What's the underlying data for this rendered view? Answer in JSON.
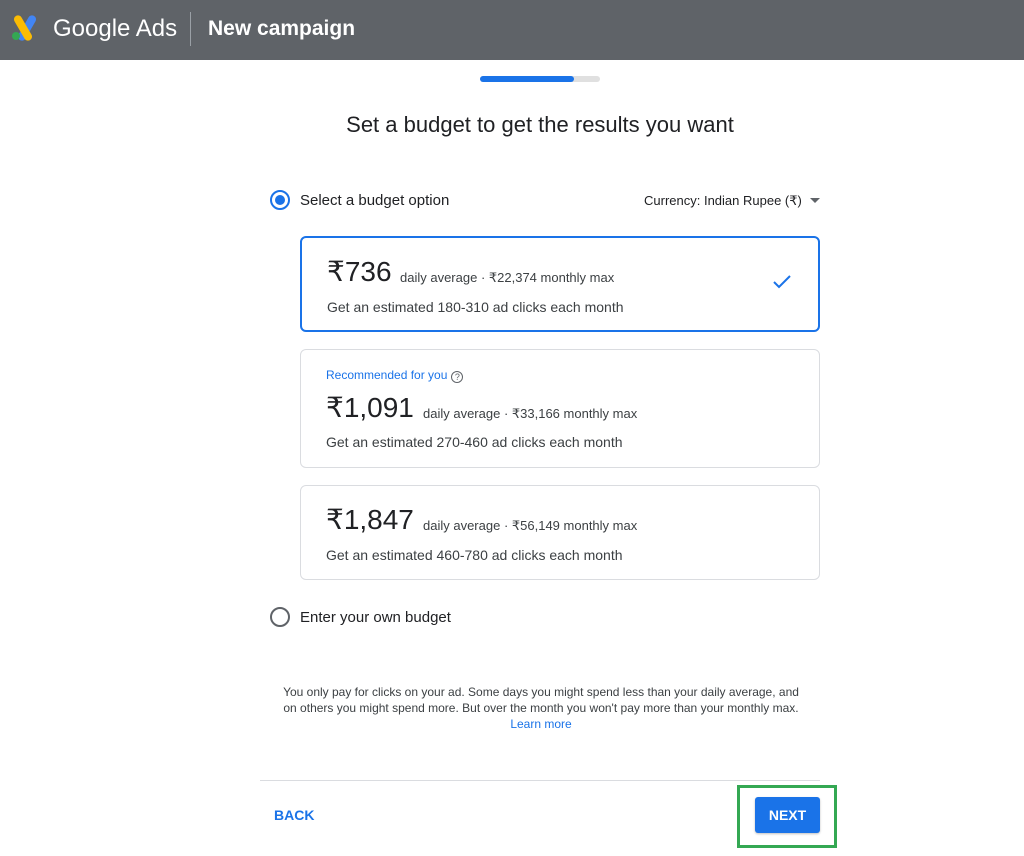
{
  "header": {
    "brand": "Google Ads",
    "page_name": "New campaign",
    "logo_icon": "google-ads-logo",
    "colors": {
      "bar": "#5f6368",
      "logo_blue": "#4285f4",
      "logo_yellow": "#fbbc04",
      "logo_green": "#34a853"
    }
  },
  "progress": {
    "fraction": 0.78
  },
  "headline": "Set a budget to get the results you want",
  "budget_option": {
    "label": "Select a budget option",
    "selected": true,
    "currency_label": "Currency: Indian Rupee (₹)",
    "currency_icon": "caret-down-icon"
  },
  "cards": [
    {
      "recommended": "",
      "amount": "₹736",
      "meta": "daily average · ₹22,374 monthly max",
      "clicks": "Get an estimated 180-310 ad clicks each month",
      "selected": true,
      "icon": "check-icon"
    },
    {
      "recommended": "Recommended for you",
      "help_icon": "help-icon",
      "help_glyph": "?",
      "amount": "₹1,091",
      "meta": "daily average · ₹33,166 monthly max",
      "clicks": "Get an estimated 270-460 ad clicks each month",
      "selected": false
    },
    {
      "recommended": "",
      "amount": "₹1,847",
      "meta": "daily average · ₹56,149 monthly max",
      "clicks": "Get an estimated 460-780 ad clicks each month",
      "selected": false
    }
  ],
  "own_budget": {
    "label": "Enter your own budget",
    "selected": false
  },
  "note": {
    "text": "You only pay for clicks on your ad. Some days you might spend less than your daily average, and on others you might spend more. But over the month you won't pay more than your monthly max.",
    "link": "Learn more"
  },
  "footer": {
    "back": "BACK",
    "next": "NEXT"
  },
  "colors": {
    "accent": "#1a73e8",
    "highlight": "#34a853",
    "border": "#dadce0"
  }
}
